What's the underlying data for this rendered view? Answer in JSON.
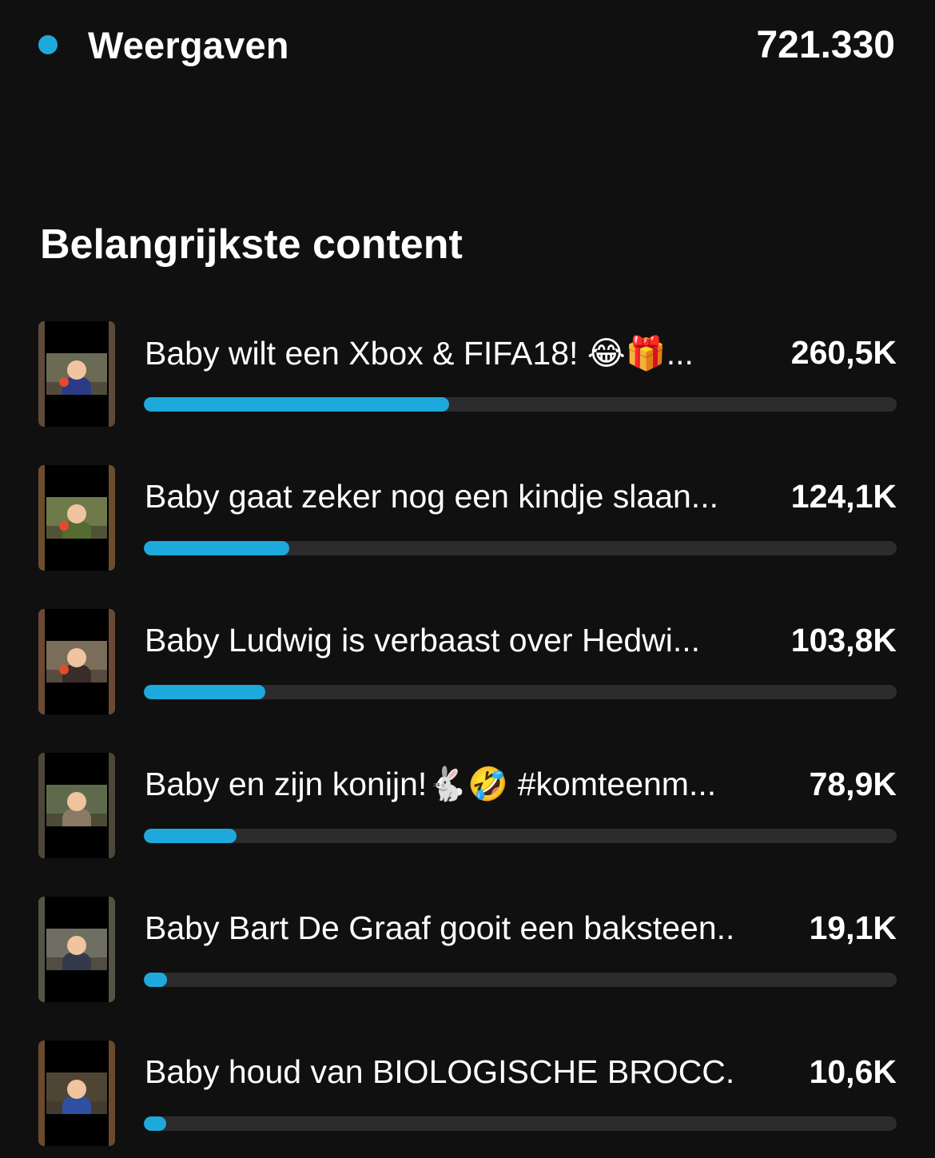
{
  "metric": {
    "label": "Weergaven",
    "value": "721.330",
    "dot_color": "#1ea9dc"
  },
  "section": {
    "title": "Belangrijkste content"
  },
  "colors": {
    "accent": "#1ea9dc",
    "track": "#2c2c2e",
    "background": "#101010"
  },
  "items": [
    {
      "title": "Baby wilt een Xbox & FIFA18! 😂🎁...",
      "value": "260,5K",
      "progress": 0.405,
      "thumb_edge": "#5e4a39",
      "thumb_scene": "#6b6a55",
      "thumb_shirt": "#2b3b86",
      "mic": true
    },
    {
      "title": "Baby gaat zeker nog een kindje slaan...",
      "value": "124,1K",
      "progress": 0.193,
      "thumb_edge": "#6b4d2e",
      "thumb_scene": "#6e7a4a",
      "thumb_shirt": "#556b2f",
      "mic": true
    },
    {
      "title": "Baby Ludwig is verbaast over Hedwi...",
      "value": "103,8K",
      "progress": 0.161,
      "thumb_edge": "#6a4a34",
      "thumb_scene": "#7a6e5a",
      "thumb_shirt": "#3a2c28",
      "mic": true
    },
    {
      "title": "Baby en zijn konijn!🐇🤣 #komteenm...",
      "value": "78,9K",
      "progress": 0.123,
      "thumb_edge": "#4e4739",
      "thumb_scene": "#5f6a4c",
      "thumb_shirt": "#8a7a66",
      "mic": false
    },
    {
      "title": "Baby Bart De Graaf gooit een baksteen...",
      "value": "19,1K",
      "progress": 0.031,
      "thumb_edge": "#525543",
      "thumb_scene": "#6e6e62",
      "thumb_shirt": "#33384a",
      "mic": false
    },
    {
      "title": "Baby houd van BIOLOGISCHE BROCC...",
      "value": "10,6K",
      "progress": 0.012,
      "thumb_edge": "#6a4a2c",
      "thumb_scene": "#4f4535",
      "thumb_shirt": "#2f4fa0",
      "mic": false
    }
  ]
}
